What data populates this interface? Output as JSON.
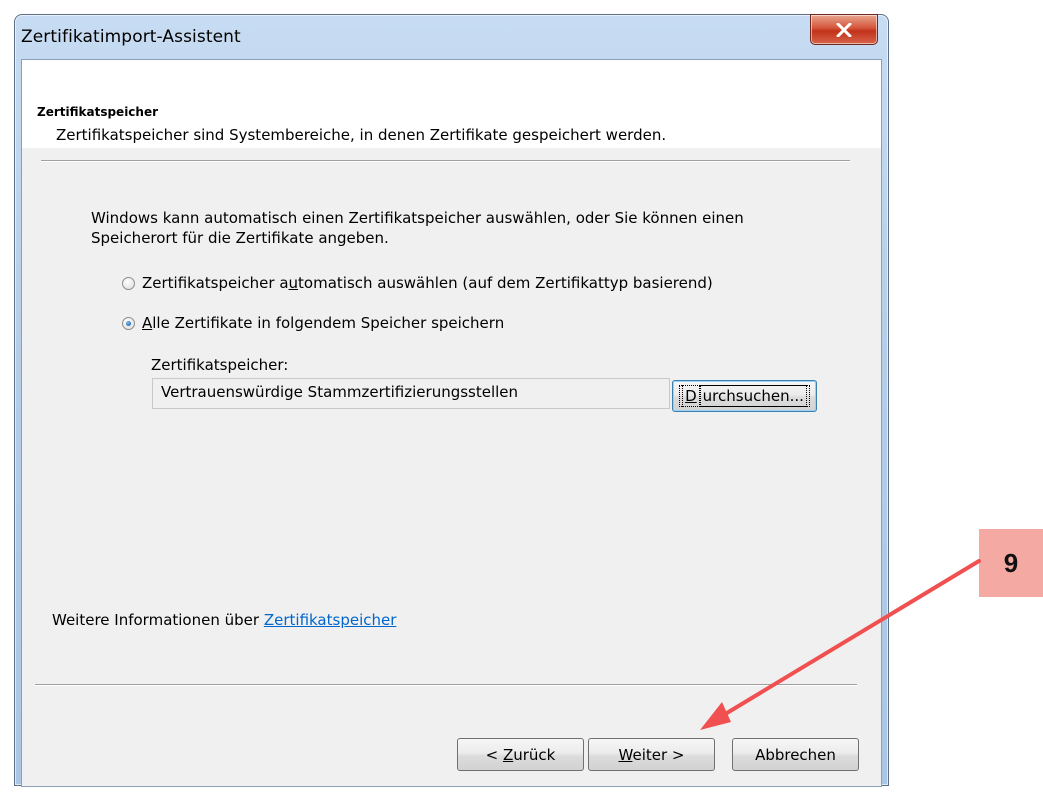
{
  "window": {
    "title": "Zertifikatimport-Assistent"
  },
  "header": {
    "section_title": "Zertifikatspeicher",
    "section_description": "Zertifikatspeicher sind Systembereiche, in denen Zertifikate gespeichert werden."
  },
  "body": {
    "intro": "Windows kann automatisch einen Zertifikatspeicher auswählen, oder Sie können einen Speicherort für die Zertifikate angeben.",
    "radio_auto": {
      "label_pre": "Zertifikatspeicher a",
      "label_accel": "u",
      "label_post": "tomatisch auswählen (auf dem Zertifikattyp basierend)",
      "checked": false
    },
    "radio_manual": {
      "label_accel": "A",
      "label_post": "lle Zertifikate in folgendem Speicher speichern",
      "checked": true
    },
    "store_label": "Zertifikatspeicher:",
    "store_value": "Vertrauenswürdige Stammzertifizierungsstellen",
    "browse_accel": "D",
    "browse_rest": "urchsuchen...",
    "more_info_prefix": "Weitere Informationen über",
    "more_info_link": "Zertifikatspeicher"
  },
  "footer": {
    "back_prefix": "< ",
    "back_accel": "Z",
    "back_rest": "urück",
    "next_accel": "W",
    "next_rest": "eiter >",
    "cancel": "Abbrechen"
  },
  "annotation": {
    "step_number": "9",
    "color": "#f05050"
  }
}
